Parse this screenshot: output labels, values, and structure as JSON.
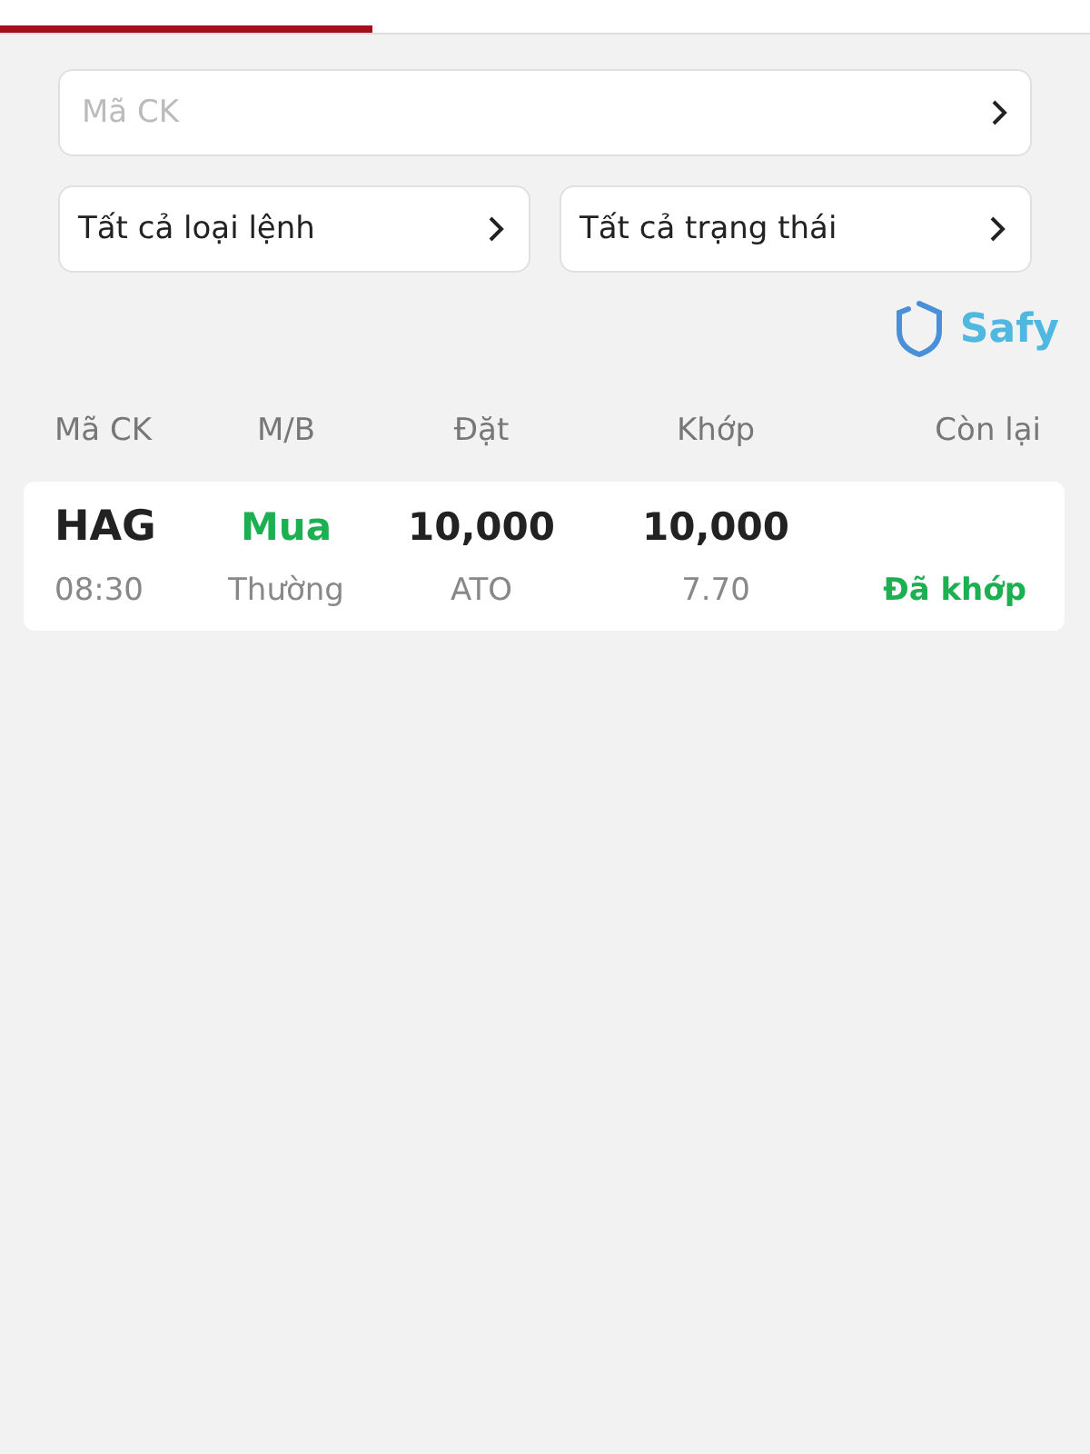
{
  "tabs": [
    {
      "selected": true
    }
  ],
  "search": {
    "placeholder": "Mã CK"
  },
  "filters": [
    {
      "label": "Tất cả loại lệnh"
    },
    {
      "label": "Tất cả trạng thái"
    }
  ],
  "brand": {
    "label": "Safy"
  },
  "table": {
    "columns": [
      "Mã CK",
      "M/B",
      "Đặt",
      "Khớp",
      "Còn lại"
    ],
    "rows": [
      {
        "symbol": "HAG",
        "time": "08:30",
        "side": {
          "text": "Mua",
          "color": "#1db052"
        },
        "order_type": "Thường",
        "qty": "10,000",
        "price": "ATO",
        "matched_qty": "10,000",
        "matched_price": "7.70",
        "status": {
          "text": "Đã khớp",
          "color": "#1db052"
        }
      }
    ]
  }
}
